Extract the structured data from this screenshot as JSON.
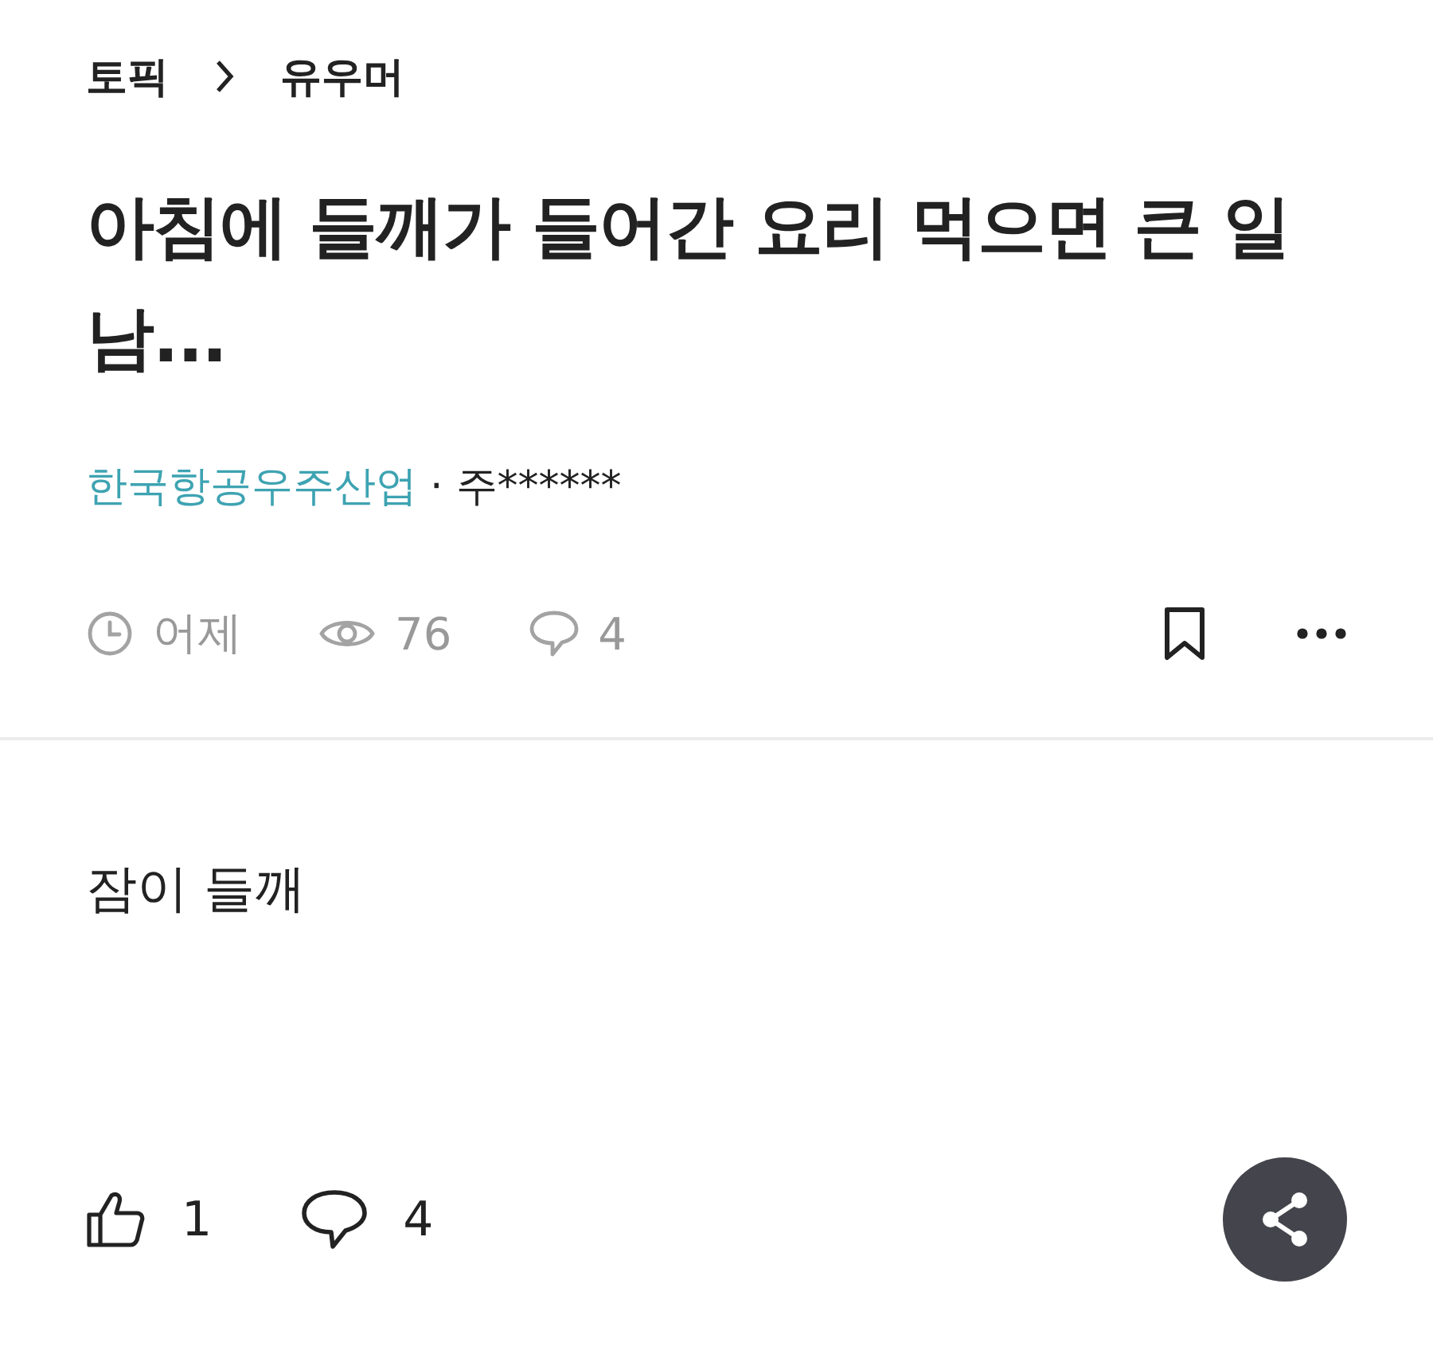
{
  "breadcrumb": [
    "토픽",
    "유우머"
  ],
  "title": "아침에 들깨가 들어간 요리 먹으면 큰 일남...",
  "author": {
    "company": "한국항공우주산업",
    "separator": "·",
    "name": "주******"
  },
  "meta": {
    "time": "어제",
    "views": "76",
    "comments": "4",
    "bookmarked": false
  },
  "body": "잠이 들깨",
  "footer": {
    "likes": "1",
    "comments": "4"
  }
}
